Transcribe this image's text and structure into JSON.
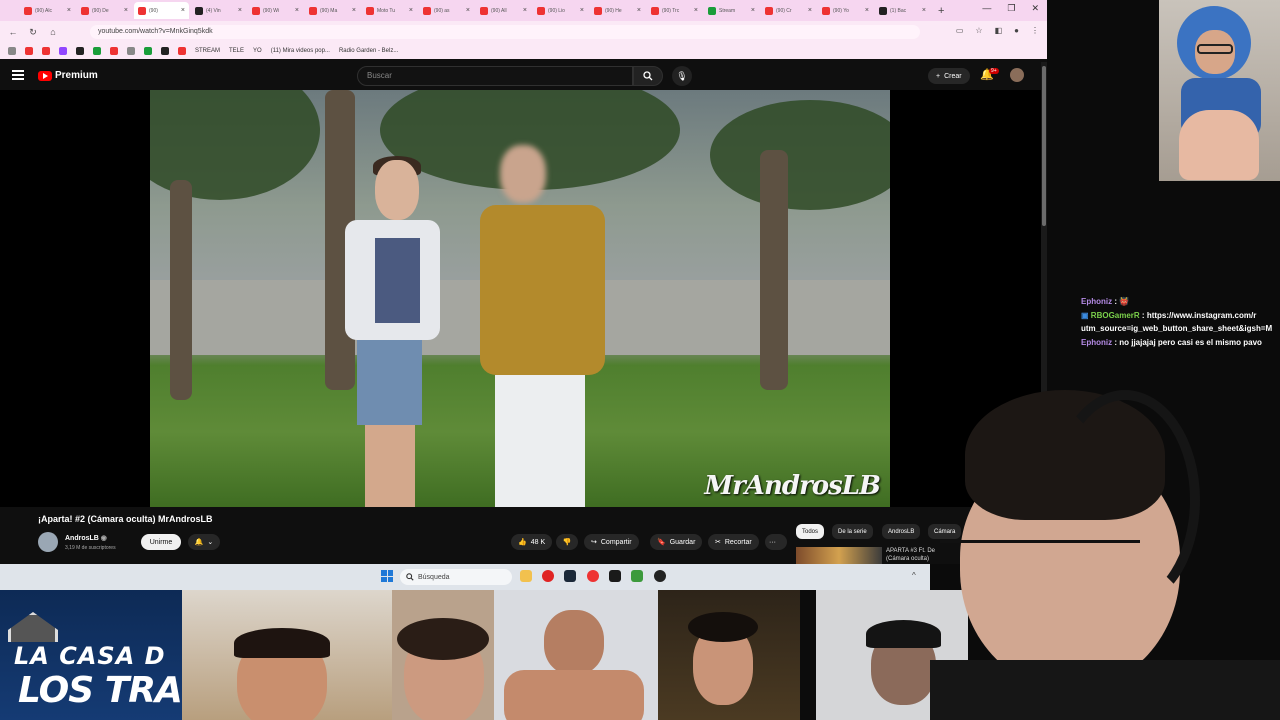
{
  "browser": {
    "tabs": [
      {
        "label": "(90) Alc",
        "fav": "yt"
      },
      {
        "label": "(90) De",
        "fav": "yt"
      },
      {
        "label": "(90)",
        "fav": "yt",
        "active": true
      },
      {
        "label": "(4) Vin",
        "fav": "tw"
      },
      {
        "label": "(90) Wi",
        "fav": "yt"
      },
      {
        "label": "(90) Ma",
        "fav": "yt"
      },
      {
        "label": "Moto Tu",
        "fav": "yt"
      },
      {
        "label": "(90) as",
        "fav": "yt"
      },
      {
        "label": "(90) All",
        "fav": "yt"
      },
      {
        "label": "(90) Lio",
        "fav": "yt"
      },
      {
        "label": "(90) He",
        "fav": "yt"
      },
      {
        "label": "(90) Trc",
        "fav": "yt"
      },
      {
        "label": "Stream",
        "fav": "kk"
      },
      {
        "label": "(90) Cr",
        "fav": "yt"
      },
      {
        "label": "(90) Yo",
        "fav": "yt"
      },
      {
        "label": "(1) Bac",
        "fav": "tw"
      }
    ],
    "new_tab": "+",
    "url": "youtube.com/watch?v=MnkGinq5kdk",
    "bookmarks": [
      {
        "label": "STREAM",
        "icon": "folder-icon"
      },
      {
        "label": "TELE",
        "icon": "folder-icon"
      },
      {
        "label": "YO",
        "icon": "folder-icon"
      },
      {
        "label": "(11) Mira videos pop...",
        "icon": "x-icon"
      },
      {
        "label": "Radio Garden - Belz...",
        "icon": "globe-icon"
      }
    ]
  },
  "youtube": {
    "logo_text": "Premium",
    "search_placeholder": "Buscar",
    "create_label": "Crear",
    "notif_badge": "9+",
    "video_watermark": "MrAndrosLB",
    "title": "¡Aparta! #2 (Cámara oculta) MrAndrosLB",
    "channel_name": "AndrosLB",
    "channel_subs": "3,19 M de suscriptores",
    "join_label": "Unirme",
    "likes": "48 K",
    "share_label": "Compartir",
    "save_label": "Guardar",
    "clip_label": "Recortar",
    "more_label": "···",
    "chips": [
      "Todos",
      "De la serie",
      "AndrosLB",
      "Cámara"
    ],
    "rec_title_1": "APARTA #3 Ft. De",
    "rec_title_2": "(Cámara oculta)"
  },
  "taskbar": {
    "search_label": "Búsqueda",
    "chevron": "^"
  },
  "chat": [
    {
      "user": "Ephoniz",
      "msg": "👹",
      "color": "#b58be6"
    },
    {
      "user": "RBOGamerR",
      "msg": "https://www.instagram.com/r utm_source=ig_web_button_share_sheet&igsh=M",
      "color": "#7bd04b"
    },
    {
      "user": "Ephoniz",
      "msg": "no jjajajaj pero casi es el mismo pavo",
      "color": "#b58be6"
    }
  ],
  "bottom_banner": {
    "line1": "LA CASA D",
    "line2": "LOS TRAVELO"
  }
}
